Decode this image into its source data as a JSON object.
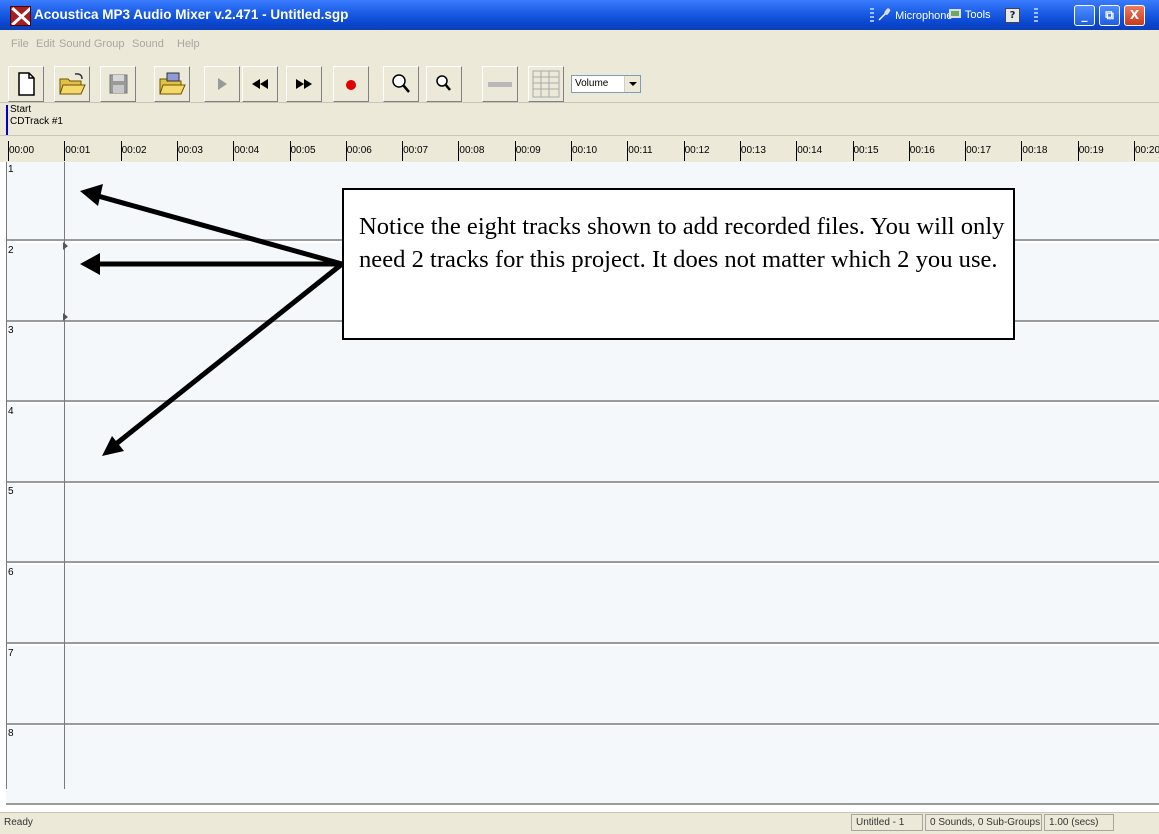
{
  "window": {
    "title": "Acoustica MP3 Audio Mixer v.2.471 - Untitled.sgp",
    "toolbar_items": {
      "microphone": "Microphone",
      "tools": "Tools"
    },
    "controls": {
      "help": "?",
      "minimize": "_",
      "restore": "⧉",
      "close": "X"
    }
  },
  "menu": {
    "items": [
      "File",
      "Edit",
      "Sound Group",
      "Sound",
      "Help"
    ]
  },
  "toolbar": {
    "buttons": [
      "new-file",
      "open-folder",
      "save",
      "open-sound",
      "play",
      "rewind",
      "fast-forward",
      "record",
      "zoom-in",
      "zoom-out",
      "volume-bar",
      "grid"
    ],
    "volume_select": {
      "value": "Volume"
    }
  },
  "info": {
    "start_label": "Start",
    "track_label": "CDTrack #1"
  },
  "ruler": {
    "labels": [
      "00:00",
      "00:01",
      "00:02",
      "00:03",
      "00:04",
      "00:05",
      "00:06",
      "00:07",
      "00:08",
      "00:09",
      "00:10",
      "00:11",
      "00:12",
      "00:13",
      "00:14",
      "00:15",
      "00:16",
      "00:17",
      "00:18",
      "00:19",
      "00:20"
    ]
  },
  "tracks": [
    {
      "number": "1"
    },
    {
      "number": "2"
    },
    {
      "number": "3"
    },
    {
      "number": "4"
    },
    {
      "number": "5"
    },
    {
      "number": "6"
    },
    {
      "number": "7"
    },
    {
      "number": "8"
    }
  ],
  "callout": {
    "text": "Notice the eight tracks shown to add recorded files.  You will only need 2 tracks for this project.  It does not matter which 2 you use."
  },
  "status": {
    "left": "Ready",
    "document": "Untitled - 1",
    "sounds": "0 Sounds, 0 Sub-Groups",
    "duration": "1.00 (secs)"
  }
}
